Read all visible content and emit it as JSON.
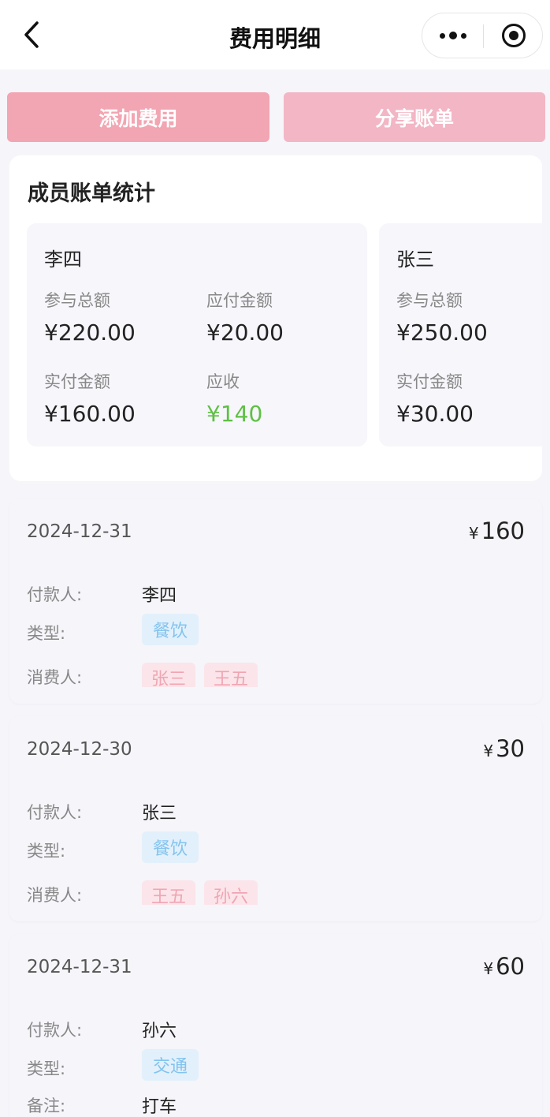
{
  "nav": {
    "title": "费用明细"
  },
  "actions": {
    "add_label": "添加费用",
    "share_label": "分享账单"
  },
  "stats": {
    "title": "成员账单统计",
    "members": [
      {
        "name": "李四",
        "total_label": "参与总额",
        "total": "¥220.00",
        "payable_label": "应付金额",
        "payable": "¥20.00",
        "paid_label": "实付金额",
        "paid": "¥160.00",
        "receivable_label": "应收",
        "receivable": "¥140"
      },
      {
        "name": "张三",
        "total_label": "参与总额",
        "total": "¥250.00",
        "paid_label": "实付金额",
        "paid": "¥30.00"
      }
    ]
  },
  "expenses": [
    {
      "date": "2024-12-31",
      "currency": "¥",
      "amount": "160",
      "payer_label": "付款人:",
      "payer": "李四",
      "type_label": "类型:",
      "type": "餐饮",
      "consumers_label": "消费人:",
      "consumers": [
        "张三",
        "王五"
      ]
    },
    {
      "date": "2024-12-30",
      "currency": "¥",
      "amount": "30",
      "payer_label": "付款人:",
      "payer": "张三",
      "type_label": "类型:",
      "type": "餐饮",
      "consumers_label": "消费人:",
      "consumers": [
        "王五",
        "孙六"
      ]
    },
    {
      "date": "2024-12-31",
      "currency": "¥",
      "amount": "60",
      "payer_label": "付款人:",
      "payer": "孙六",
      "type_label": "类型:",
      "type": "交通",
      "note_label": "备注:",
      "note": "打车"
    }
  ],
  "colors": {
    "add_button": "#f2a5b2",
    "share_button": "#f2b6c5",
    "receivable_green": "#5ec043",
    "type_tag_bg": "#e2f0fb",
    "type_tag_text": "#83c3ee",
    "person_tag_bg": "#fbe5ea",
    "person_tag_text": "#f0a5b3"
  },
  "icons": [
    "back-icon",
    "more-icon",
    "target-icon"
  ]
}
